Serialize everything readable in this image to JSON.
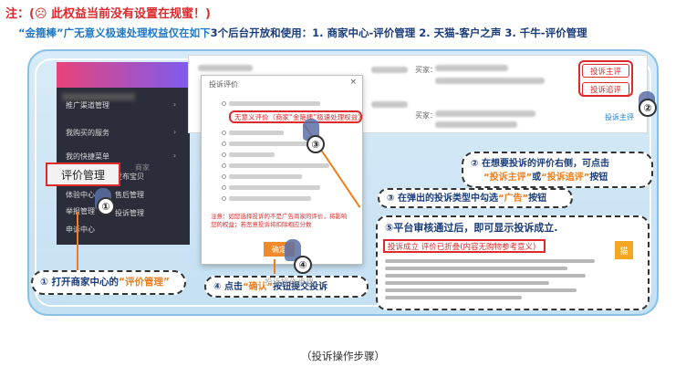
{
  "note": "注：(☹ 此权益当前没有设置在规蜜！)",
  "subtitle": {
    "part1": "“金箍棒”广无意义极速处理权益仅在如下",
    "part2": "3个后台开放和使用：1. 商家中心-评价管理    2. 天猫-客户之声    3. 千牛-评价管理"
  },
  "left_menu": [
    {
      "label": "推广渠道管理"
    },
    {
      "label": "我购买的服务"
    },
    {
      "label": "我的快捷菜单"
    },
    {
      "label": "体验中心"
    },
    {
      "label": "举报管理"
    },
    {
      "label": "申诉中心"
    }
  ],
  "left_right_menu": [
    "发布宝贝",
    "售后管理",
    "投诉管理"
  ],
  "left_side_tag": "商家",
  "selected_menu": "评价管理",
  "top_screen": {
    "buyer_label": "买家：",
    "complaint_link": "投诉主评"
  },
  "buttons": {
    "complaint_main": "投诉主评",
    "complaint_followup": "投诉追评"
  },
  "dialog": {
    "title": "投诉评价",
    "close": "×",
    "ad_option": "无意义评价（商家“金箍棒”极速处理权益）",
    "warning": "注意：如您选择投诉的不是广告商家的评价，将影响您的权益；若恶意投诉将扣除相应分数",
    "confirm": "确定"
  },
  "callouts": {
    "c1": {
      "pre": "① 打开商家中心的",
      "hl": "“评价管理”"
    },
    "c2": {
      "l1": "② 在想要投诉的评价右侧，可点击",
      "hl1": "“投诉主评”",
      "mid": "或",
      "hl2": "“投诉追评”",
      "post": "按钮"
    },
    "c3": {
      "pre": "③ 在弹出的投诉类型中勾选",
      "hl": "“广告”",
      "post": "按钮"
    },
    "c4": {
      "pre": "④ 点击",
      "hl": "“确认”",
      "post": "按钮提交投诉"
    }
  },
  "result": {
    "heading": "⑤平台审核通过后，即可显示投诉成立.",
    "tag": "投诉成立 评价已折叠(内容无购物参考意义)"
  },
  "steps": [
    "①",
    "②",
    "③",
    "④"
  ],
  "watermark": "投诉操作步骤",
  "caption": "（投诉操作步骤）"
}
